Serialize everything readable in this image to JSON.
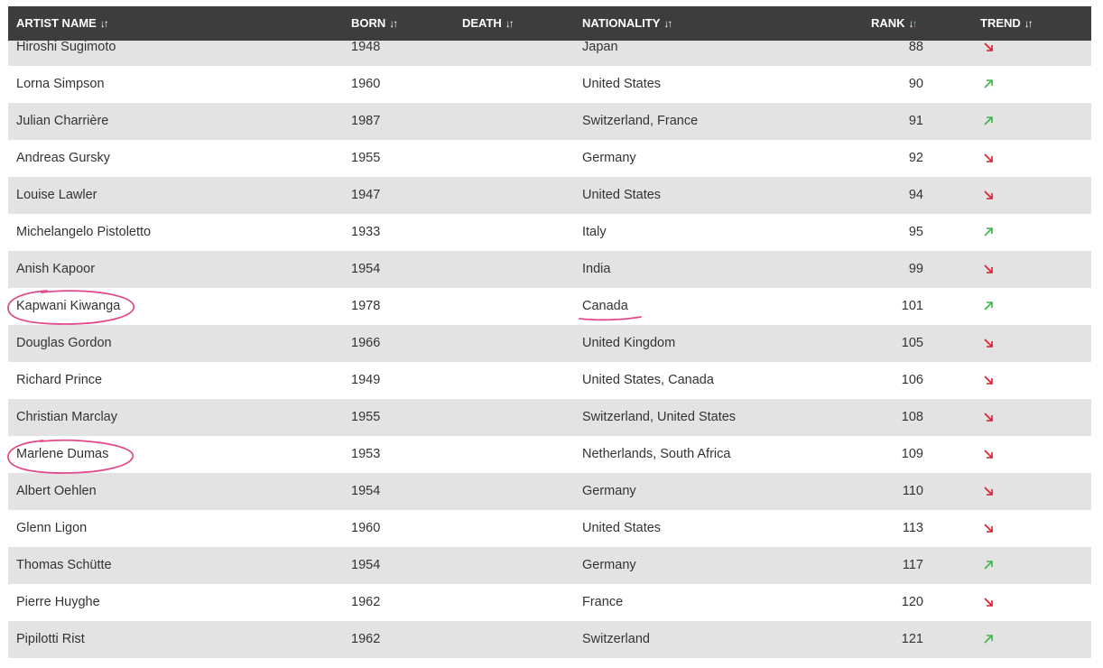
{
  "columns": {
    "artist_name": "ARTIST NAME",
    "born": "BORN",
    "death": "DEATH",
    "nationality": "NATIONALITY",
    "rank": "RANK",
    "trend": "TREND"
  },
  "colors": {
    "header_bg": "#3d3d3d",
    "row_alt_bg": "#e3e3e3",
    "trend_up": "#3cb44b",
    "trend_down": "#e0192d",
    "annotation": "#e0498a",
    "active_sort": "#5ab4d6"
  },
  "rows": [
    {
      "name": "Hiroshi Sugimoto",
      "born": "1948",
      "death": "",
      "nationality": "Japan",
      "rank": "88",
      "trend": "down"
    },
    {
      "name": "Lorna Simpson",
      "born": "1960",
      "death": "",
      "nationality": "United States",
      "rank": "90",
      "trend": "up"
    },
    {
      "name": "Julian Charrière",
      "born": "1987",
      "death": "",
      "nationality": "Switzerland, France",
      "rank": "91",
      "trend": "up"
    },
    {
      "name": "Andreas Gursky",
      "born": "1955",
      "death": "",
      "nationality": "Germany",
      "rank": "92",
      "trend": "down"
    },
    {
      "name": "Louise Lawler",
      "born": "1947",
      "death": "",
      "nationality": "United States",
      "rank": "94",
      "trend": "down"
    },
    {
      "name": "Michelangelo Pistoletto",
      "born": "1933",
      "death": "",
      "nationality": "Italy",
      "rank": "95",
      "trend": "up"
    },
    {
      "name": "Anish Kapoor",
      "born": "1954",
      "death": "",
      "nationality": "India",
      "rank": "99",
      "trend": "down"
    },
    {
      "name": "Kapwani Kiwanga",
      "born": "1978",
      "death": "",
      "nationality": "Canada",
      "rank": "101",
      "trend": "up"
    },
    {
      "name": "Douglas Gordon",
      "born": "1966",
      "death": "",
      "nationality": "United Kingdom",
      "rank": "105",
      "trend": "down"
    },
    {
      "name": "Richard Prince",
      "born": "1949",
      "death": "",
      "nationality": "United States, Canada",
      "rank": "106",
      "trend": "down"
    },
    {
      "name": "Christian Marclay",
      "born": "1955",
      "death": "",
      "nationality": "Switzerland, United States",
      "rank": "108",
      "trend": "down"
    },
    {
      "name": "Marlene Dumas",
      "born": "1953",
      "death": "",
      "nationality": "Netherlands, South Africa",
      "rank": "109",
      "trend": "down"
    },
    {
      "name": "Albert Oehlen",
      "born": "1954",
      "death": "",
      "nationality": "Germany",
      "rank": "110",
      "trend": "down"
    },
    {
      "name": "Glenn Ligon",
      "born": "1960",
      "death": "",
      "nationality": "United States",
      "rank": "113",
      "trend": "down"
    },
    {
      "name": "Thomas Schütte",
      "born": "1954",
      "death": "",
      "nationality": "Germany",
      "rank": "117",
      "trend": "up"
    },
    {
      "name": "Pierre Huyghe",
      "born": "1962",
      "death": "",
      "nationality": "France",
      "rank": "120",
      "trend": "down"
    },
    {
      "name": "Pipilotti Rist",
      "born": "1962",
      "death": "",
      "nationality": "Switzerland",
      "rank": "121",
      "trend": "up"
    }
  ]
}
